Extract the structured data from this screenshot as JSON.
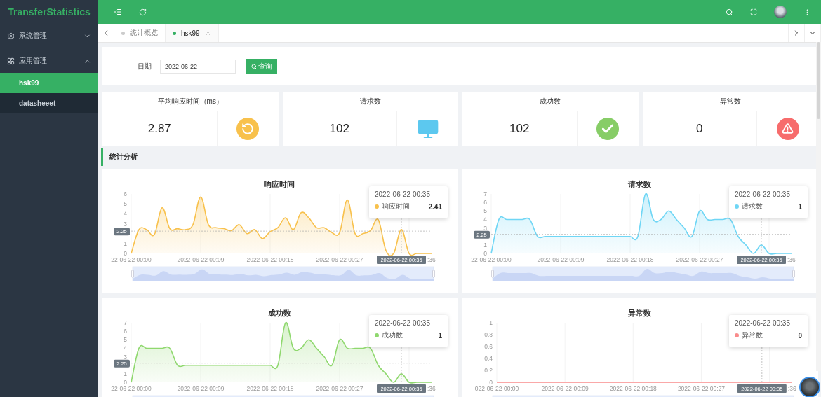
{
  "sidebar": {
    "brand": "TransferStatistics",
    "menu": [
      {
        "kind": "settings",
        "label": "系统管理",
        "expanded": false
      },
      {
        "kind": "apps",
        "label": "应用管理",
        "expanded": true,
        "children": [
          {
            "label": "hsk99",
            "selected": true
          },
          {
            "label": "datasheeet",
            "selected": false
          }
        ]
      }
    ]
  },
  "tabs": [
    {
      "label": "统计概览",
      "selected": false
    },
    {
      "label": "hsk99",
      "selected": true
    }
  ],
  "query": {
    "label": "日期",
    "value": "2022-06-22",
    "button": "查询"
  },
  "stats": [
    {
      "kind": "timer",
      "title": "平均响应时间（ms）",
      "value": "2.87",
      "color": "#f8c14c"
    },
    {
      "kind": "monitor",
      "title": "请求数",
      "value": "102",
      "color": "#5cc8ef"
    },
    {
      "kind": "check",
      "title": "成功数",
      "value": "102",
      "color": "#87cd67"
    },
    {
      "kind": "warning",
      "title": "异常数",
      "value": "0",
      "color": "#f76c6c"
    }
  ],
  "section_title": "统计分析",
  "charts": [
    {
      "tooltip": {
        "title": "2022-06-22 00:35",
        "series_name": "响应时间",
        "value": "2.41"
      },
      "pointer": {
        "x_label": "2022-06-22 00:35"
      },
      "axis_tail": ":36",
      "chart_data": {
        "type": "area",
        "title": "响应时间",
        "grid": true,
        "categories": [
          "22-06-22 00:00",
          null,
          null,
          null,
          null,
          null,
          null,
          null,
          null,
          "2022-06-22 00:09",
          null,
          null,
          null,
          null,
          null,
          null,
          null,
          null,
          "2022-06-22 00:18",
          null,
          null,
          null,
          null,
          null,
          null,
          null,
          null,
          "2022-06-22 00:27",
          null,
          null,
          null,
          null,
          null,
          null,
          null,
          null,
          null,
          null,
          null,
          null
        ],
        "series": [
          {
            "color": "#f8c14c",
            "values": [
              0,
              2.4,
              2.4,
              1.9,
              4.6,
              2.5,
              2.5,
              2.4,
              2.9,
              5.7,
              2.9,
              2.6,
              2.5,
              2.3,
              2.9,
              2.0,
              2.4,
              1.5,
              2.2,
              2.6,
              3.6,
              2.4,
              4.1,
              3.6,
              2.6,
              2.6,
              2.1,
              2.1,
              5.4,
              2.0,
              2.0,
              2.3,
              3.4,
              0.3,
              0,
              2.41,
              0,
              0,
              0,
              0
            ]
          }
        ],
        "ylim": [
          0,
          6
        ],
        "yticks": [
          0,
          1,
          3,
          4,
          5,
          6
        ],
        "ref_lines": [
          {
            "axis": "y",
            "value": 2.25,
            "label": "2.25"
          }
        ]
      }
    },
    {
      "tooltip": {
        "title": "2022-06-22 00:35",
        "series_name": "请求数",
        "value": "1"
      },
      "pointer": {
        "x_label": "2022-06-22 00:35"
      },
      "axis_tail": ":36",
      "chart_data": {
        "type": "area",
        "title": "请求数",
        "grid": true,
        "categories": [
          "22-06-22 00:00",
          null,
          null,
          null,
          null,
          null,
          null,
          null,
          null,
          "2022-06-22 00:09",
          null,
          null,
          null,
          null,
          null,
          null,
          null,
          null,
          "2022-06-22 00:18",
          null,
          null,
          null,
          null,
          null,
          null,
          null,
          null,
          "2022-06-22 00:27",
          null,
          null,
          null,
          null,
          null,
          null,
          null,
          null,
          null,
          null,
          null,
          null
        ],
        "series": [
          {
            "color": "#6fd6f5",
            "values": [
              0,
              4,
              4,
              4,
              4,
              4,
              2,
              2,
              2,
              2,
              2,
              2,
              2,
              2,
              2,
              2,
              2,
              2,
              2,
              2,
              7,
              4,
              4,
              5,
              4,
              3,
              2,
              5,
              4,
              4,
              4,
              4,
              2,
              1,
              0,
              1,
              0,
              0,
              0,
              0
            ]
          }
        ],
        "ylim": [
          0,
          7
        ],
        "yticks": [
          0,
          1,
          3,
          4,
          5,
          6,
          7
        ],
        "ref_lines": [
          {
            "axis": "y",
            "value": 2.25,
            "label": "2.25"
          }
        ]
      }
    },
    {
      "tooltip": {
        "title": "2022-06-22 00:35",
        "series_name": "成功数",
        "value": "1"
      },
      "pointer": {
        "x_label": "2022-06-22 00:35"
      },
      "axis_tail": ":36",
      "chart_data": {
        "type": "area",
        "title": "成功数",
        "grid": true,
        "categories": [
          "22-06-22 00:00",
          null,
          null,
          null,
          null,
          null,
          null,
          null,
          null,
          "2022-06-22 00:09",
          null,
          null,
          null,
          null,
          null,
          null,
          null,
          null,
          "2022-06-22 00:18",
          null,
          null,
          null,
          null,
          null,
          null,
          null,
          null,
          "2022-06-22 00:27",
          null,
          null,
          null,
          null,
          null,
          null,
          null,
          null,
          null,
          null,
          null,
          null
        ],
        "series": [
          {
            "color": "#8fd86e",
            "values": [
              0,
              4,
              4,
              4,
              4,
              4,
              2,
              2,
              2,
              2,
              2,
              2,
              2,
              2,
              2,
              2,
              2,
              2,
              2,
              2,
              7,
              4,
              4,
              5,
              4,
              3,
              2,
              5,
              4,
              4,
              4,
              4,
              2,
              1,
              0,
              1,
              0,
              0,
              0,
              0
            ]
          }
        ],
        "ylim": [
          0,
          7
        ],
        "yticks": [
          0,
          1,
          3,
          4,
          5,
          6,
          7
        ],
        "ref_lines": [
          {
            "axis": "y",
            "value": 2.25,
            "label": "2.25"
          }
        ]
      }
    },
    {
      "tooltip": {
        "title": "2022-06-22 00:35",
        "series_name": "异常数",
        "value": "0"
      },
      "pointer": {
        "x_label": "2022-06-22 00:35"
      },
      "axis_tail": ":36",
      "chart_data": {
        "type": "line",
        "title": "异常数",
        "grid": true,
        "categories": [
          "022-06-22 00:00",
          null,
          null,
          null,
          null,
          null,
          null,
          null,
          null,
          "2022-06-22 00:09",
          null,
          null,
          null,
          null,
          null,
          null,
          null,
          null,
          "2022-06-22 00:18",
          null,
          null,
          null,
          null,
          null,
          null,
          null,
          null,
          "2022-06-22 00:27",
          null,
          null,
          null,
          null,
          null,
          null,
          null,
          null,
          null,
          null,
          null,
          null
        ],
        "series": [
          {
            "color": "#f98b8b",
            "values": [
              0,
              0,
              0,
              0,
              0,
              0,
              0,
              0,
              0,
              0,
              0,
              0,
              0,
              0,
              0,
              0,
              0,
              0,
              0,
              0,
              0,
              0,
              0,
              0,
              0,
              0,
              0,
              0,
              0,
              0,
              0,
              0,
              0,
              0,
              0,
              0,
              0,
              0,
              0,
              0
            ]
          }
        ],
        "ylim": [
          0,
          1
        ],
        "yticks": [
          0,
          0.2,
          0.4,
          0.6,
          0.8,
          1
        ]
      }
    }
  ]
}
